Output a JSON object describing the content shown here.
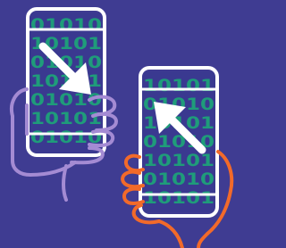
{
  "colors": {
    "background": "#3f3c92",
    "screen": "#3a3990",
    "binary": "#1f9c7a",
    "outline": "#ffffff",
    "left_hand": "#a48bd3",
    "right_hand": "#f26a2a"
  },
  "left_phone": {
    "screen_binary_rows": [
      "01010",
      "10101",
      "01010",
      "10101",
      "01010",
      "10101",
      "01010"
    ],
    "arrow_icon": "arrow-down-right-icon"
  },
  "right_phone": {
    "screen_binary_rows": [
      "10101",
      "01010",
      "10101",
      "01010",
      "10101",
      "01010",
      "10101"
    ],
    "arrow_icon": "arrow-up-left-icon"
  }
}
